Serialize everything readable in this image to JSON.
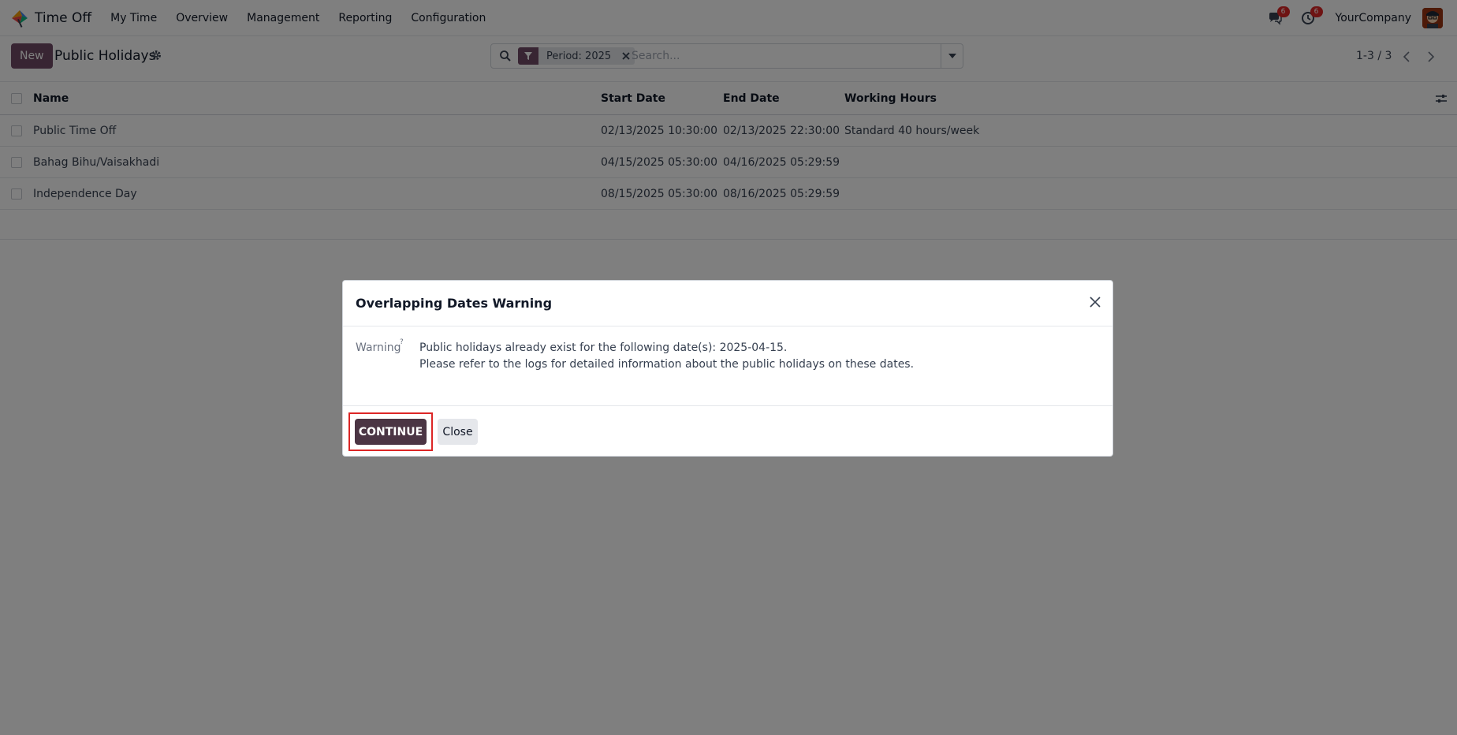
{
  "navbar": {
    "app_name": "Time Off",
    "menu": [
      "My Time",
      "Overview",
      "Management",
      "Reporting",
      "Configuration"
    ],
    "messages_count": "6",
    "activities_count": "6",
    "company": "YourCompany",
    "icons": {
      "app": "time-off-app-icon",
      "messages": "chat-icon",
      "activities": "clock-icon",
      "avatar": "user-avatar"
    }
  },
  "control": {
    "new_label": "New",
    "title": "Public Holidays",
    "facet_label": "Period: 2025",
    "search_placeholder": "Search...",
    "pager": "1-3 / 3"
  },
  "table": {
    "columns": [
      "Name",
      "Start Date",
      "End Date",
      "Working Hours"
    ],
    "rows": [
      {
        "name": "Public Time Off",
        "start": "02/13/2025 10:30:00",
        "end": "02/13/2025 22:30:00",
        "hours": "Standard 40 hours/week"
      },
      {
        "name": "Bahag Bihu/Vaisakhadi",
        "start": "04/15/2025 05:30:00",
        "end": "04/16/2025 05:29:59",
        "hours": ""
      },
      {
        "name": "Independence Day",
        "start": "08/15/2025 05:30:00",
        "end": "08/16/2025 05:29:59",
        "hours": ""
      }
    ]
  },
  "dialog": {
    "title": "Overlapping Dates Warning",
    "field_label": "Warning",
    "help_mark": "?",
    "message_line1": "Public holidays already exist for the following date(s): 2025-04-15.",
    "message_line2": "Please refer to the logs for detailed information about the public holidays on these dates.",
    "continue_label": "CONTINUE",
    "close_label": "Close"
  },
  "colors": {
    "brand": "#714b67",
    "primary_dark": "#4b3544",
    "badge": "#dc2626",
    "focus": "#dc2626"
  }
}
